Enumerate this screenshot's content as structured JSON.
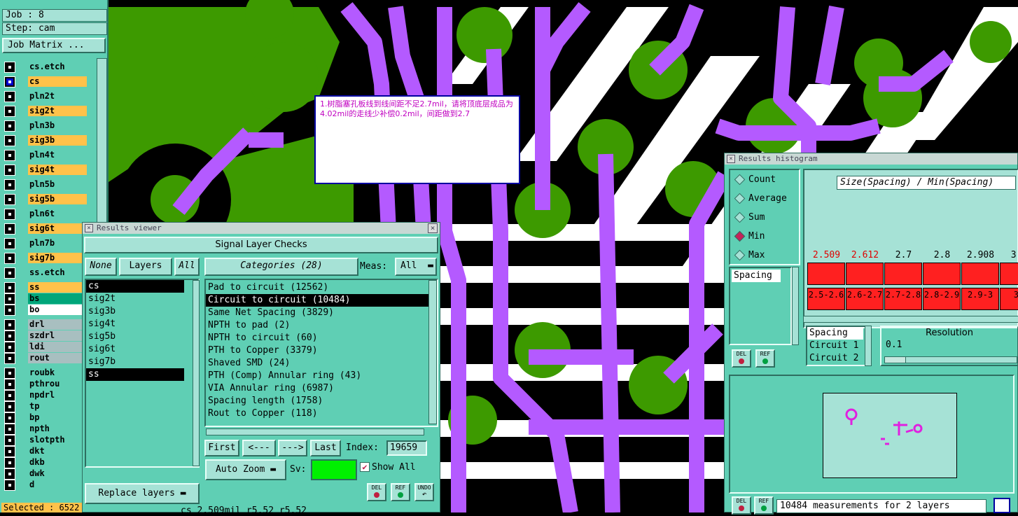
{
  "job": {
    "job_label": "Job : 8",
    "step_label": "Step: cam",
    "matrix_button": "Job Matrix ..."
  },
  "layers": [
    {
      "name": "cs.etch",
      "color": "teal"
    },
    {
      "name": "cs",
      "color": "orange"
    },
    {
      "name": "pln2t",
      "color": "teal"
    },
    {
      "name": "sig2t",
      "color": "orange"
    },
    {
      "name": "pln3b",
      "color": "teal"
    },
    {
      "name": "sig3b",
      "color": "orange"
    },
    {
      "name": "pln4t",
      "color": "teal"
    },
    {
      "name": "sig4t",
      "color": "orange"
    },
    {
      "name": "pln5b",
      "color": "teal"
    },
    {
      "name": "sig5b",
      "color": "orange"
    },
    {
      "name": "pln6t",
      "color": "teal"
    },
    {
      "name": "sig6t",
      "color": "orange"
    },
    {
      "name": "pln7b",
      "color": "teal"
    },
    {
      "name": "sig7b",
      "color": "orange"
    },
    {
      "name": "ss.etch",
      "color": "teal"
    },
    {
      "name": "ss",
      "color": "orange"
    },
    {
      "name": "bs",
      "color": "green"
    },
    {
      "name": "bo",
      "color": "white"
    },
    {
      "name": "drl",
      "color": "gray"
    },
    {
      "name": "szdrl",
      "color": "gray"
    },
    {
      "name": "ldi",
      "color": "gray"
    },
    {
      "name": "rout",
      "color": "gray"
    },
    {
      "name": "roubk",
      "color": "teal"
    },
    {
      "name": "pthrou",
      "color": "teal"
    },
    {
      "name": "npdrl",
      "color": "teal"
    },
    {
      "name": "tp",
      "color": "teal"
    },
    {
      "name": "bp",
      "color": "teal"
    },
    {
      "name": "npth",
      "color": "teal"
    },
    {
      "name": "slotpth",
      "color": "teal"
    },
    {
      "name": "dkt",
      "color": "teal"
    },
    {
      "name": "dkb",
      "color": "teal"
    },
    {
      "name": "dwk",
      "color": "teal"
    },
    {
      "name": "d",
      "color": "teal"
    }
  ],
  "status": {
    "selected": "Selected : 6522",
    "bottom_readout": "cs 2.509mil  r5.52  r5.52"
  },
  "results_viewer": {
    "title": "Results viewer",
    "header": "Signal Layer Checks",
    "none_btn": "None",
    "layers_btn": "Layers",
    "all_btn": "All",
    "categories_btn": "Categories (28)",
    "meas_label": "Meas:",
    "meas_value": "All",
    "layers": [
      "cs",
      "sig2t",
      "sig3b",
      "sig4t",
      "sig5b",
      "sig6t",
      "sig7b",
      "ss"
    ],
    "categories": [
      "Pad to circuit (12562)",
      "Circuit to circuit (10484)",
      "Same Net Spacing (3829)",
      "NPTH to pad (2)",
      "NPTH to circuit (60)",
      "PTH to Copper (3379)",
      "Shaved SMD (24)",
      "PTH (Comp) Annular ring (43)",
      "VIA Annular ring (6987)",
      "Spacing length (1758)",
      "Rout to Copper (118)"
    ],
    "nav": {
      "first": "First",
      "prev": "<---",
      "next": "--->",
      "last": "Last",
      "index_label": "Index:",
      "index_value": "19659"
    },
    "auto_zoom": "Auto Zoom",
    "sv_label": "Sv:",
    "show_all": "Show All",
    "replace_layers": "Replace layers",
    "del": "DEL",
    "ref": "REF",
    "undo": "UNDO"
  },
  "histogram": {
    "title": "Results histogram",
    "modes": [
      "Count",
      "Average",
      "Sum",
      "Min",
      "Max"
    ],
    "selected_mode": "Min",
    "header": "Size(Spacing) / Min(Spacing)",
    "measure_list": [
      "Spacing"
    ],
    "bars": [
      {
        "value": "2.509",
        "range": "2.5-2.6",
        "red_label": true
      },
      {
        "value": "2.612",
        "range": "2.6-2.7",
        "red_label": true
      },
      {
        "value": "2.7",
        "range": "2.7-2.8",
        "red_label": false
      },
      {
        "value": "2.8",
        "range": "2.8-2.9",
        "red_label": false
      },
      {
        "value": "2.908",
        "range": "2.9-3",
        "red_label": false
      },
      {
        "value": "3.0",
        "range": "3-",
        "red_label": false
      }
    ],
    "legend_items": [
      "Spacing",
      "Circuit 1",
      "Circuit 2"
    ],
    "resolution_label": "Resolution",
    "resolution_value": "0.1",
    "measurements": "10484 measurements for 2 layers",
    "del": "DEL",
    "ref": "REF"
  },
  "note": {
    "text": "1.树脂塞孔板线到线间距不足2.7mil，请将顶底层成品为4.02mil的走线少补偿0.2mil，间距做到2.7"
  },
  "colors": {
    "bg_panel": "#5fcfb4",
    "orange": "#ffc24a",
    "trace": "#b45aff",
    "pad": "#3d9a00",
    "bar": "#ff2020"
  }
}
